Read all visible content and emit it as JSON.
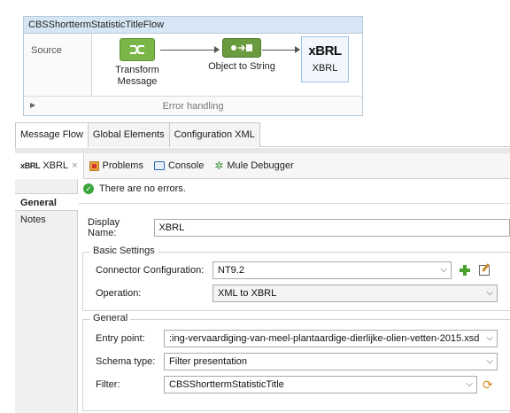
{
  "flow": {
    "title": "CBSShorttermStatisticTitleFlow",
    "source_label": "Source",
    "nodes": [
      {
        "label": "Transform\nMessage",
        "icon": "transform-message-icon"
      },
      {
        "label": "Object to String",
        "icon": "object-to-string-icon"
      },
      {
        "label": "XBRL",
        "badge": "xBRL",
        "icon": "xbrl-connector-icon"
      }
    ],
    "error_handling": "Error handling"
  },
  "editor_tabs": [
    "Message Flow",
    "Global Elements",
    "Configuration XML"
  ],
  "view_tabs": {
    "xbrl_badge": "xBRL",
    "xbrl": "XBRL",
    "close": "×",
    "problems": "Problems",
    "console": "Console",
    "debugger": "Mule Debugger"
  },
  "sidebar": {
    "items": [
      "General",
      "Notes"
    ]
  },
  "status": {
    "text": "There are no errors.",
    "icon": "ok-check-icon"
  },
  "form": {
    "display_name_label": "Display Name:",
    "display_name_value": "XBRL",
    "basic_settings_title": "Basic Settings",
    "connector_config_label": "Connector Configuration:",
    "connector_config_value": "NT9.2",
    "operation_label": "Operation:",
    "operation_value": "XML to XBRL",
    "general_title": "General",
    "entry_point_label": "Entry point:",
    "entry_point_value": ":ing-vervaardiging-van-meel-plantaardige-dierlijke-olien-vetten-2015.xsd",
    "schema_type_label": "Schema type:",
    "schema_type_value": "Filter presentation",
    "filter_label": "Filter:",
    "filter_value": "CBSShorttermStatisticTitle"
  },
  "colors": {
    "flow_header": "#d6e6f4",
    "transform_green": "#7ab648",
    "ok_green": "#3aa53a",
    "add_green": "#4aa02c"
  }
}
